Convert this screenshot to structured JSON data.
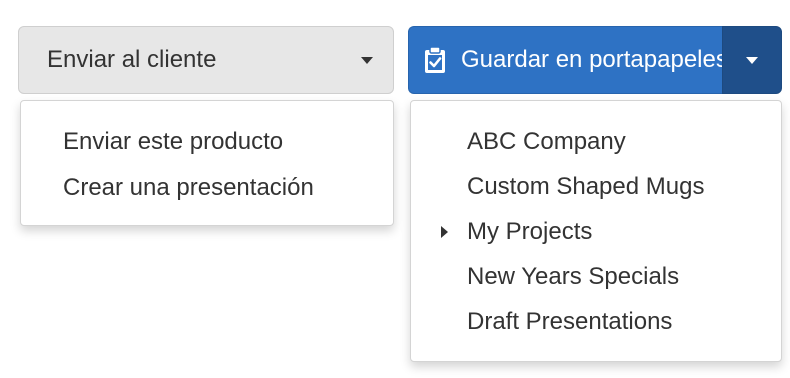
{
  "send_to_client": {
    "button_label": "Enviar al cliente",
    "caret_icon": "chevron-down-icon",
    "menu_items": [
      {
        "label": "Enviar este producto"
      },
      {
        "label": "Crear una presentación"
      }
    ]
  },
  "save_to_clipboard": {
    "button_label": "Guardar en portapapeles",
    "icon": "clipboard-check-icon",
    "caret_icon": "chevron-down-icon",
    "menu_items": [
      {
        "label": "ABC Company",
        "has_submenu": false
      },
      {
        "label": "Custom Shaped Mugs",
        "has_submenu": false
      },
      {
        "label": "My Projects",
        "has_submenu": true
      },
      {
        "label": "New Years Specials",
        "has_submenu": false
      },
      {
        "label": "Draft Presentations",
        "has_submenu": false
      }
    ]
  },
  "colors": {
    "primary_blue": "#2e72c4",
    "toggle_blue": "#1f4f8a",
    "default_button_bg": "#e7e7e7",
    "text": "#333333"
  }
}
